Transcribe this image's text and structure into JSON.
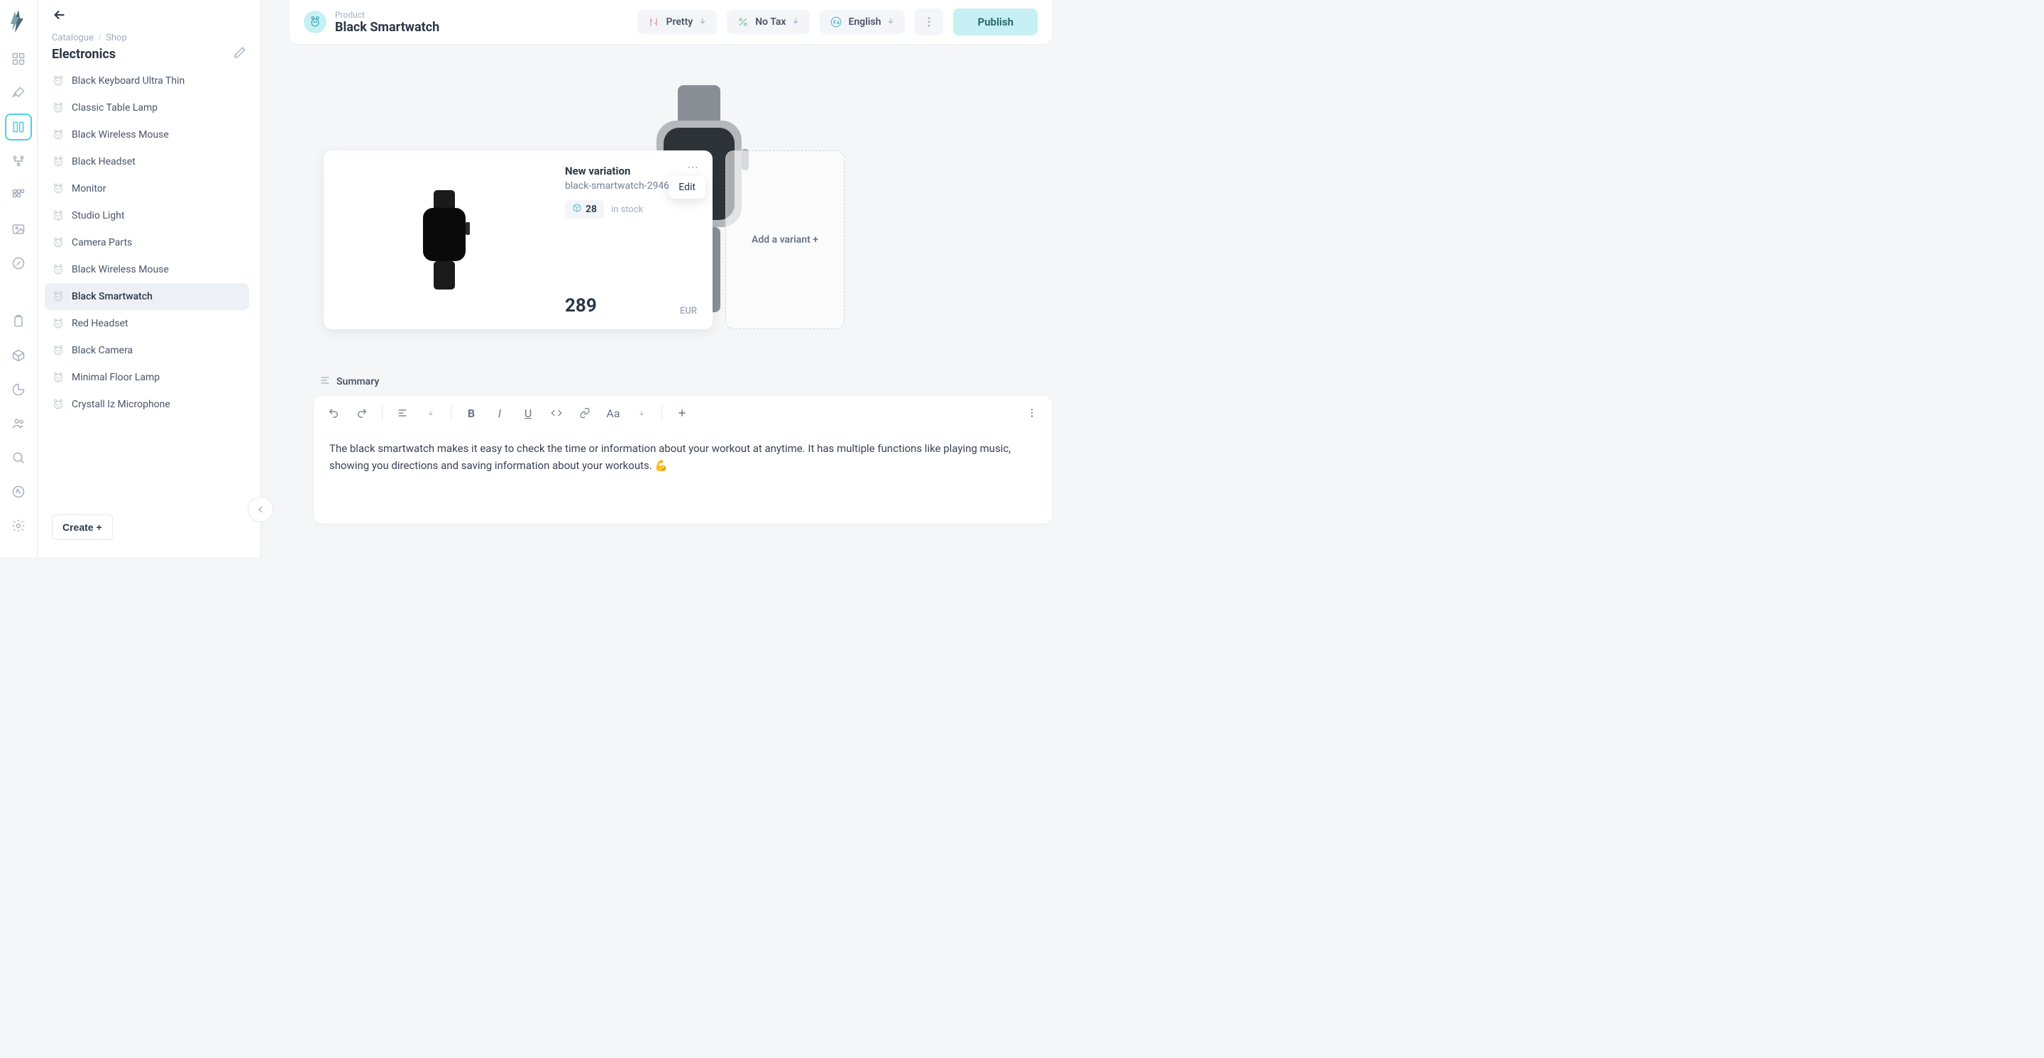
{
  "breadcrumb": {
    "a": "Catalogue",
    "b": "Shop"
  },
  "category_title": "Electronics",
  "sidebar": {
    "items": [
      {
        "label": "Black Keyboard Ultra Thin"
      },
      {
        "label": "Classic Table Lamp"
      },
      {
        "label": "Black Wireless Mouse"
      },
      {
        "label": "Black Headset"
      },
      {
        "label": "Monitor"
      },
      {
        "label": "Studio Light"
      },
      {
        "label": "Camera Parts"
      },
      {
        "label": "Black Wireless Mouse"
      },
      {
        "label": "Black Smartwatch"
      },
      {
        "label": "Red Headset"
      },
      {
        "label": "Black Camera"
      },
      {
        "label": "Minimal Floor Lamp"
      },
      {
        "label": "Crystall Iz Microphone"
      }
    ],
    "selected_index": 8,
    "create_label": "Create +"
  },
  "header": {
    "product_label": "Product",
    "product_title": "Black Smartwatch",
    "pretty": "Pretty",
    "tax": "No Tax",
    "lang": "English",
    "publish": "Publish"
  },
  "variant": {
    "title": "New variation",
    "sku": "black-smartwatch-2946",
    "stock_qty": "28",
    "stock_label": "in stock",
    "price": "289",
    "currency": "EUR",
    "menu_edit": "Edit"
  },
  "add_variant_label": "Add a variant +",
  "summary": {
    "label": "Summary",
    "text": "The black smartwatch makes it easy to check the time or information about your workout at anytime. It has multiple functions like playing music, showing you directions and saving information about your workouts. 💪"
  },
  "toolbar_typography": "Aa"
}
